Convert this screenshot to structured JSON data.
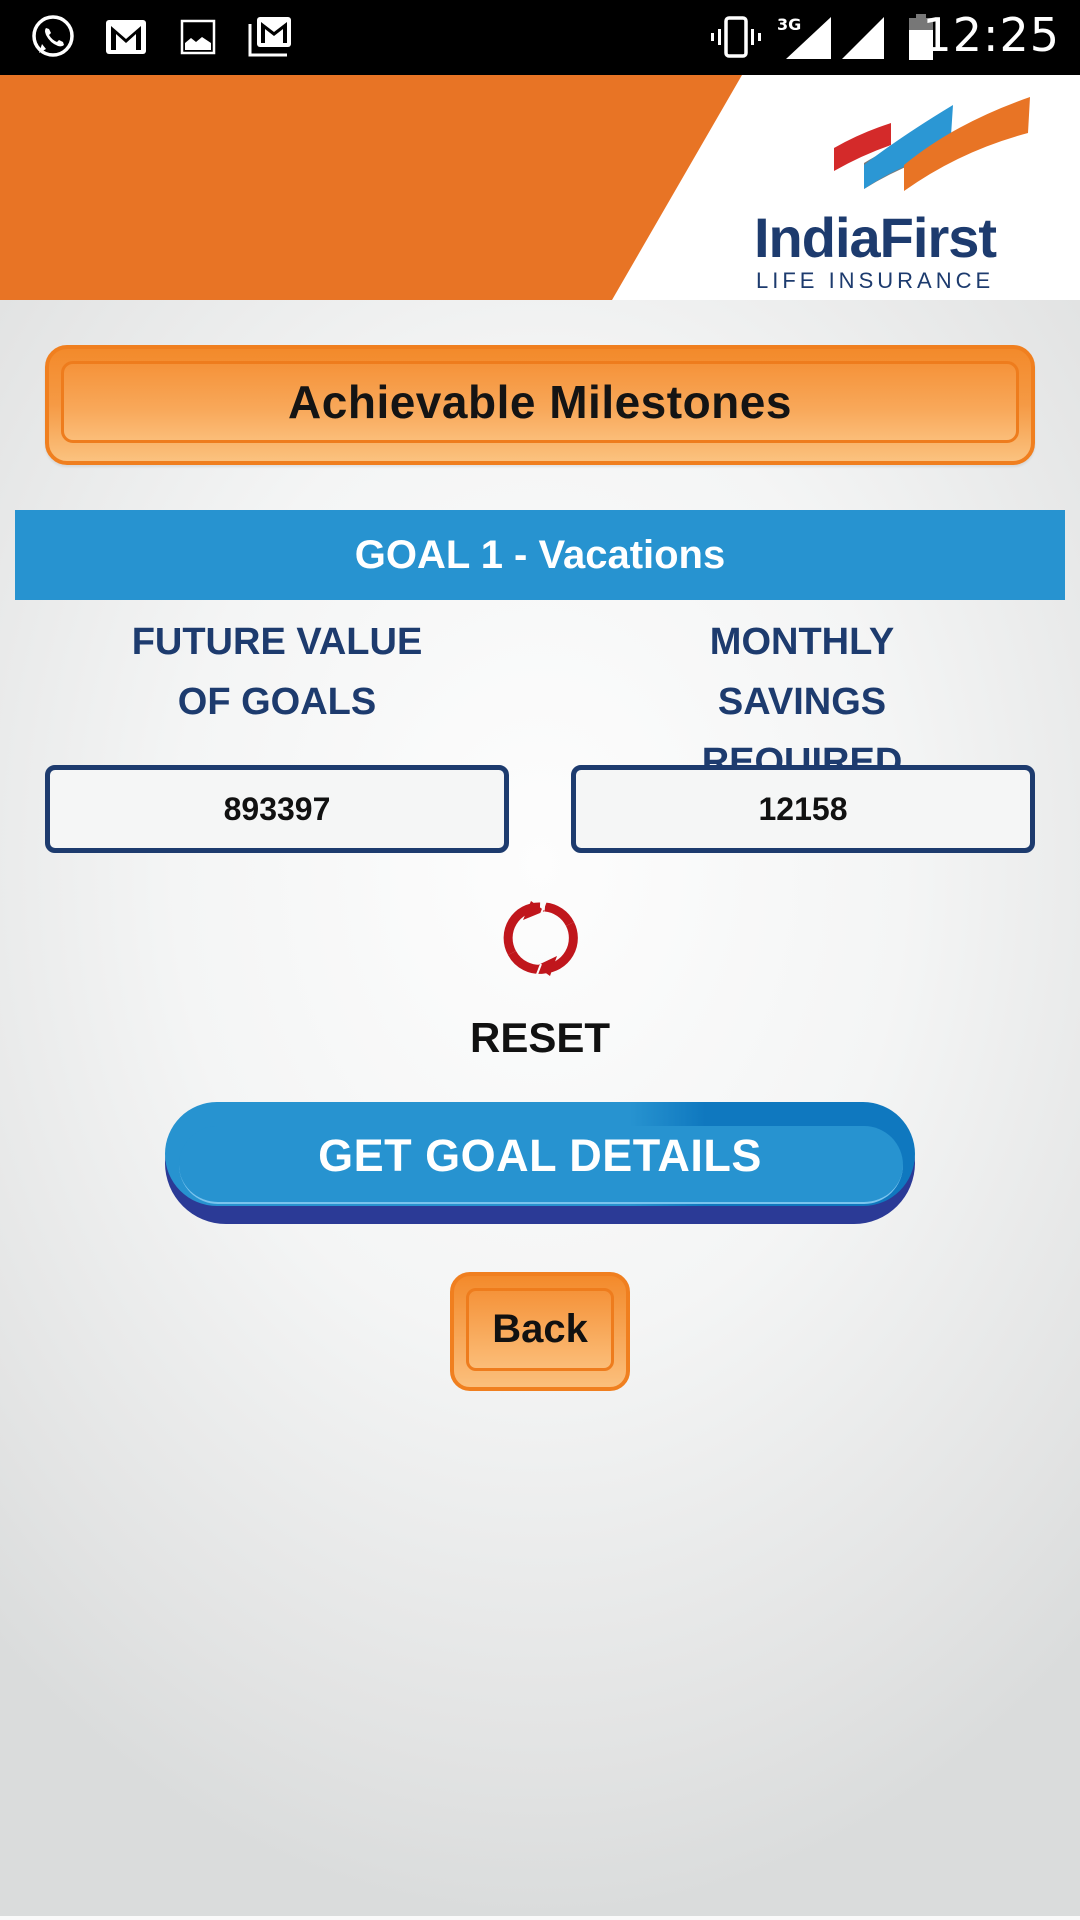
{
  "status_bar": {
    "time": "12:25",
    "network_type": "3G",
    "notification_icons": [
      "whatsapp-icon",
      "gmail-icon",
      "gallery-icon",
      "gmail-multiple-icon"
    ],
    "system_icons": [
      "vibrate-icon",
      "signal-3g-icon",
      "signal-icon",
      "battery-icon"
    ]
  },
  "header": {
    "brand_name": "IndiaFirst",
    "brand_tagline": "LIFE INSURANCE",
    "colors": {
      "orange": "#e87425",
      "navy": "#1d3b6e",
      "red": "#d42a2a",
      "blue": "#2b97d4",
      "gray": "#7a7a7a"
    }
  },
  "page": {
    "title_button": "Achievable Milestones",
    "goal_title": "GOAL 1 - Vacations",
    "future_value_label": "FUTURE VALUE OF GOALS",
    "monthly_savings_label": "MONTHLY SAVINGS REQUIRED",
    "future_value": "893397",
    "monthly_savings": "12158",
    "reset_label": "RESET",
    "get_goal_details_label": "GET GOAL DETAILS",
    "back_label": "Back"
  },
  "colors": {
    "accent_orange": "#f38a2b",
    "accent_blue": "#2793d0",
    "label_navy": "#1d3b6e",
    "reset_red": "#c0161c"
  }
}
